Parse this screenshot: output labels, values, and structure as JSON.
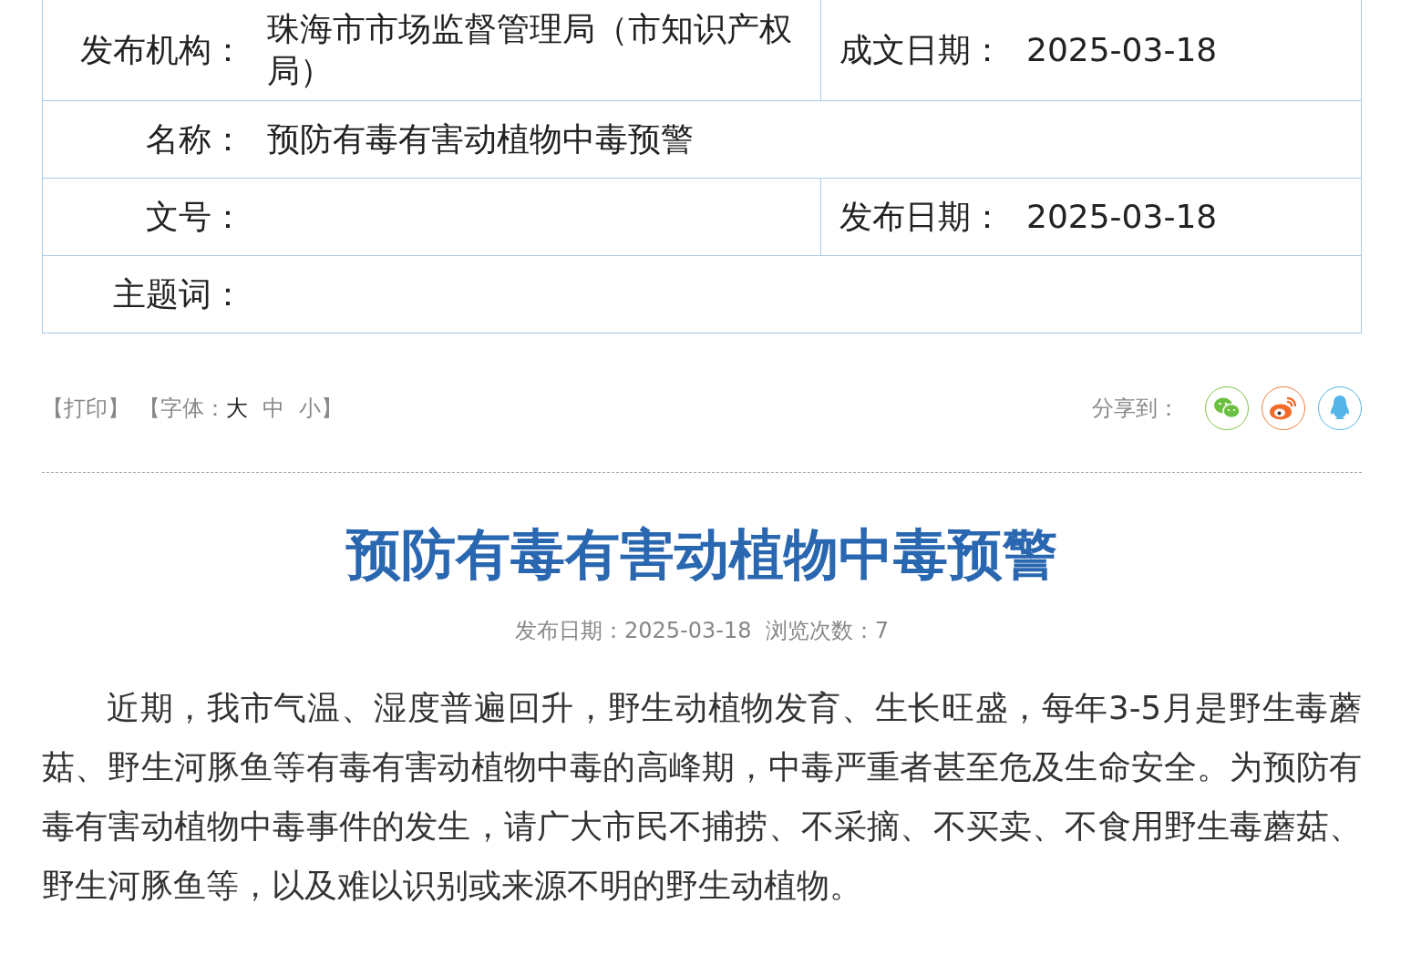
{
  "info_table": {
    "rows": [
      {
        "cells": [
          {
            "label": "发布机构：",
            "value": "珠海市市场监督管理局（市知识产权局）"
          },
          {
            "label": "成文日期：",
            "value": "2025-03-18"
          }
        ]
      },
      {
        "cells": [
          {
            "label": "名称：",
            "value": "预防有毒有害动植物中毒预警"
          }
        ]
      },
      {
        "cells": [
          {
            "label": "文号："
          },
          {
            "label": "发布日期：",
            "value": "2025-03-18"
          }
        ]
      },
      {
        "cells": [
          {
            "label": "主题词："
          }
        ]
      }
    ]
  },
  "toolbar": {
    "print": "【打印】",
    "font_label": "【字体：",
    "font_sizes": [
      {
        "label": "大",
        "selected": true
      },
      {
        "label": "中",
        "selected": false
      },
      {
        "label": "小",
        "selected": false
      }
    ],
    "font_end": "】",
    "share_label": "分享到：",
    "share_buttons": [
      {
        "kind": "wechat"
      },
      {
        "kind": "weibo"
      },
      {
        "kind": "qq"
      }
    ]
  },
  "article": {
    "title": "预防有毒有害动植物中毒预警",
    "meta": "发布日期：2025-03-18  浏览次数：7",
    "body": "近期，我市气温、湿度普遍回升，野生动植物发育、生长旺盛，每年3-5月是野生毒蘑菇、野生河豚鱼等有毒有害动植物中毒的高峰期，中毒严重者甚至危及生命安全。为预防有毒有害动植物中毒事件的发生，请广大市民不捕捞、不采摘、不买卖、不食用野生毒蘑菇、野生河豚鱼等，以及难以识别或来源不明的野生动植物。"
  }
}
